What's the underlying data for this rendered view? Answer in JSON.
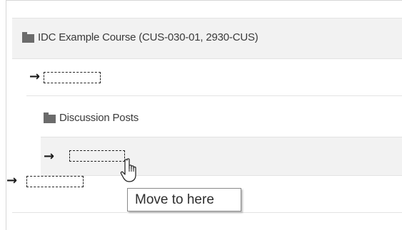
{
  "course": {
    "name": "IDC Example Course (CUS-030-01, 2930-CUS)",
    "icon": "folder-icon"
  },
  "folder": {
    "name": "Discussion Posts",
    "icon": "folder-icon"
  },
  "move_targets": [
    {
      "arrow": "→",
      "icon": "arrow-right-icon"
    },
    {
      "arrow": "→",
      "icon": "arrow-right-icon"
    },
    {
      "arrow": "→",
      "icon": "arrow-right-icon"
    }
  ],
  "tooltip": {
    "text": "Move to here"
  },
  "cursor": {
    "icon": "hand-pointer-icon"
  }
}
